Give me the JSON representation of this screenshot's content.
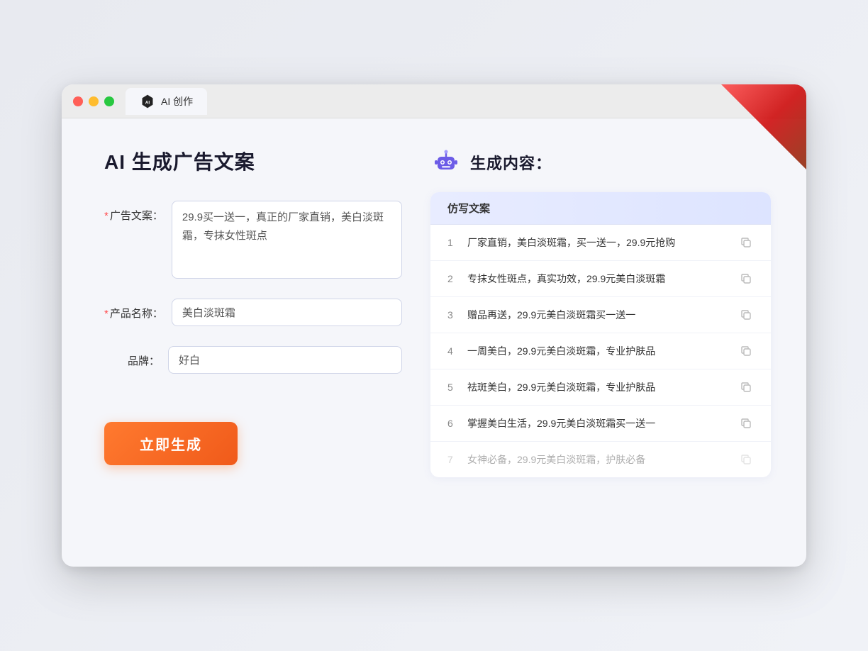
{
  "window": {
    "tab_label": "AI 创作"
  },
  "left_panel": {
    "title": "AI 生成广告文案",
    "form": {
      "ad_copy_label": "广告文案：",
      "ad_copy_required": "*",
      "ad_copy_value": "29.9买一送一，真正的厂家直销，美白淡斑霜，专抹女性斑点",
      "product_name_label": "产品名称：",
      "product_name_required": "*",
      "product_name_value": "美白淡斑霜",
      "brand_label": "品牌：",
      "brand_value": "好白"
    },
    "generate_btn": "立即生成"
  },
  "right_panel": {
    "title": "生成内容：",
    "table_header": "仿写文案",
    "results": [
      {
        "num": "1",
        "text": "厂家直销，美白淡斑霜，买一送一，29.9元抢购",
        "faded": false
      },
      {
        "num": "2",
        "text": "专抹女性斑点，真实功效，29.9元美白淡斑霜",
        "faded": false
      },
      {
        "num": "3",
        "text": "赠品再送，29.9元美白淡斑霜买一送一",
        "faded": false
      },
      {
        "num": "4",
        "text": "一周美白，29.9元美白淡斑霜，专业护肤品",
        "faded": false
      },
      {
        "num": "5",
        "text": "祛斑美白，29.9元美白淡斑霜，专业护肤品",
        "faded": false
      },
      {
        "num": "6",
        "text": "掌握美白生活，29.9元美白淡斑霜买一送一",
        "faded": false
      },
      {
        "num": "7",
        "text": "女神必备，29.9元美白淡斑霜，护肤必备",
        "faded": true
      }
    ]
  }
}
